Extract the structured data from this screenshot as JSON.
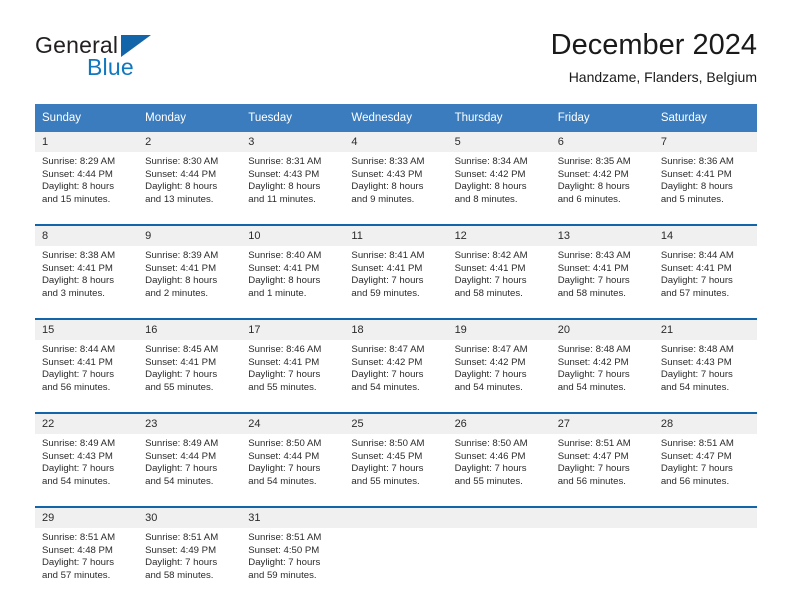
{
  "brand": {
    "name_top": "General",
    "name_bottom": "Blue",
    "triangle_color": "#1265a8",
    "blue_text_color": "#1178c0"
  },
  "header": {
    "month_title": "December 2024",
    "location": "Handzame, Flanders, Belgium"
  },
  "theme": {
    "header_row_bg": "#3a7cbe",
    "header_row_text": "#ffffff",
    "daynum_bg": "#f0f0f0",
    "separator": "#1265a8",
    "cell_text": "#2b2b2b"
  },
  "weekday_headers": [
    "Sunday",
    "Monday",
    "Tuesday",
    "Wednesday",
    "Thursday",
    "Friday",
    "Saturday"
  ],
  "weeks": [
    {
      "days": [
        {
          "day": "1",
          "sunrise": "Sunrise: 8:29 AM",
          "sunset": "Sunset: 4:44 PM",
          "daylight_1": "Daylight: 8 hours",
          "daylight_2": "and 15 minutes."
        },
        {
          "day": "2",
          "sunrise": "Sunrise: 8:30 AM",
          "sunset": "Sunset: 4:44 PM",
          "daylight_1": "Daylight: 8 hours",
          "daylight_2": "and 13 minutes."
        },
        {
          "day": "3",
          "sunrise": "Sunrise: 8:31 AM",
          "sunset": "Sunset: 4:43 PM",
          "daylight_1": "Daylight: 8 hours",
          "daylight_2": "and 11 minutes."
        },
        {
          "day": "4",
          "sunrise": "Sunrise: 8:33 AM",
          "sunset": "Sunset: 4:43 PM",
          "daylight_1": "Daylight: 8 hours",
          "daylight_2": "and 9 minutes."
        },
        {
          "day": "5",
          "sunrise": "Sunrise: 8:34 AM",
          "sunset": "Sunset: 4:42 PM",
          "daylight_1": "Daylight: 8 hours",
          "daylight_2": "and 8 minutes."
        },
        {
          "day": "6",
          "sunrise": "Sunrise: 8:35 AM",
          "sunset": "Sunset: 4:42 PM",
          "daylight_1": "Daylight: 8 hours",
          "daylight_2": "and 6 minutes."
        },
        {
          "day": "7",
          "sunrise": "Sunrise: 8:36 AM",
          "sunset": "Sunset: 4:41 PM",
          "daylight_1": "Daylight: 8 hours",
          "daylight_2": "and 5 minutes."
        }
      ]
    },
    {
      "days": [
        {
          "day": "8",
          "sunrise": "Sunrise: 8:38 AM",
          "sunset": "Sunset: 4:41 PM",
          "daylight_1": "Daylight: 8 hours",
          "daylight_2": "and 3 minutes."
        },
        {
          "day": "9",
          "sunrise": "Sunrise: 8:39 AM",
          "sunset": "Sunset: 4:41 PM",
          "daylight_1": "Daylight: 8 hours",
          "daylight_2": "and 2 minutes."
        },
        {
          "day": "10",
          "sunrise": "Sunrise: 8:40 AM",
          "sunset": "Sunset: 4:41 PM",
          "daylight_1": "Daylight: 8 hours",
          "daylight_2": "and 1 minute."
        },
        {
          "day": "11",
          "sunrise": "Sunrise: 8:41 AM",
          "sunset": "Sunset: 4:41 PM",
          "daylight_1": "Daylight: 7 hours",
          "daylight_2": "and 59 minutes."
        },
        {
          "day": "12",
          "sunrise": "Sunrise: 8:42 AM",
          "sunset": "Sunset: 4:41 PM",
          "daylight_1": "Daylight: 7 hours",
          "daylight_2": "and 58 minutes."
        },
        {
          "day": "13",
          "sunrise": "Sunrise: 8:43 AM",
          "sunset": "Sunset: 4:41 PM",
          "daylight_1": "Daylight: 7 hours",
          "daylight_2": "and 58 minutes."
        },
        {
          "day": "14",
          "sunrise": "Sunrise: 8:44 AM",
          "sunset": "Sunset: 4:41 PM",
          "daylight_1": "Daylight: 7 hours",
          "daylight_2": "and 57 minutes."
        }
      ]
    },
    {
      "days": [
        {
          "day": "15",
          "sunrise": "Sunrise: 8:44 AM",
          "sunset": "Sunset: 4:41 PM",
          "daylight_1": "Daylight: 7 hours",
          "daylight_2": "and 56 minutes."
        },
        {
          "day": "16",
          "sunrise": "Sunrise: 8:45 AM",
          "sunset": "Sunset: 4:41 PM",
          "daylight_1": "Daylight: 7 hours",
          "daylight_2": "and 55 minutes."
        },
        {
          "day": "17",
          "sunrise": "Sunrise: 8:46 AM",
          "sunset": "Sunset: 4:41 PM",
          "daylight_1": "Daylight: 7 hours",
          "daylight_2": "and 55 minutes."
        },
        {
          "day": "18",
          "sunrise": "Sunrise: 8:47 AM",
          "sunset": "Sunset: 4:42 PM",
          "daylight_1": "Daylight: 7 hours",
          "daylight_2": "and 54 minutes."
        },
        {
          "day": "19",
          "sunrise": "Sunrise: 8:47 AM",
          "sunset": "Sunset: 4:42 PM",
          "daylight_1": "Daylight: 7 hours",
          "daylight_2": "and 54 minutes."
        },
        {
          "day": "20",
          "sunrise": "Sunrise: 8:48 AM",
          "sunset": "Sunset: 4:42 PM",
          "daylight_1": "Daylight: 7 hours",
          "daylight_2": "and 54 minutes."
        },
        {
          "day": "21",
          "sunrise": "Sunrise: 8:48 AM",
          "sunset": "Sunset: 4:43 PM",
          "daylight_1": "Daylight: 7 hours",
          "daylight_2": "and 54 minutes."
        }
      ]
    },
    {
      "days": [
        {
          "day": "22",
          "sunrise": "Sunrise: 8:49 AM",
          "sunset": "Sunset: 4:43 PM",
          "daylight_1": "Daylight: 7 hours",
          "daylight_2": "and 54 minutes."
        },
        {
          "day": "23",
          "sunrise": "Sunrise: 8:49 AM",
          "sunset": "Sunset: 4:44 PM",
          "daylight_1": "Daylight: 7 hours",
          "daylight_2": "and 54 minutes."
        },
        {
          "day": "24",
          "sunrise": "Sunrise: 8:50 AM",
          "sunset": "Sunset: 4:44 PM",
          "daylight_1": "Daylight: 7 hours",
          "daylight_2": "and 54 minutes."
        },
        {
          "day": "25",
          "sunrise": "Sunrise: 8:50 AM",
          "sunset": "Sunset: 4:45 PM",
          "daylight_1": "Daylight: 7 hours",
          "daylight_2": "and 55 minutes."
        },
        {
          "day": "26",
          "sunrise": "Sunrise: 8:50 AM",
          "sunset": "Sunset: 4:46 PM",
          "daylight_1": "Daylight: 7 hours",
          "daylight_2": "and 55 minutes."
        },
        {
          "day": "27",
          "sunrise": "Sunrise: 8:51 AM",
          "sunset": "Sunset: 4:47 PM",
          "daylight_1": "Daylight: 7 hours",
          "daylight_2": "and 56 minutes."
        },
        {
          "day": "28",
          "sunrise": "Sunrise: 8:51 AM",
          "sunset": "Sunset: 4:47 PM",
          "daylight_1": "Daylight: 7 hours",
          "daylight_2": "and 56 minutes."
        }
      ]
    },
    {
      "days": [
        {
          "day": "29",
          "sunrise": "Sunrise: 8:51 AM",
          "sunset": "Sunset: 4:48 PM",
          "daylight_1": "Daylight: 7 hours",
          "daylight_2": "and 57 minutes."
        },
        {
          "day": "30",
          "sunrise": "Sunrise: 8:51 AM",
          "sunset": "Sunset: 4:49 PM",
          "daylight_1": "Daylight: 7 hours",
          "daylight_2": "and 58 minutes."
        },
        {
          "day": "31",
          "sunrise": "Sunrise: 8:51 AM",
          "sunset": "Sunset: 4:50 PM",
          "daylight_1": "Daylight: 7 hours",
          "daylight_2": "and 59 minutes."
        },
        {
          "day": "",
          "sunrise": "",
          "sunset": "",
          "daylight_1": "",
          "daylight_2": ""
        },
        {
          "day": "",
          "sunrise": "",
          "sunset": "",
          "daylight_1": "",
          "daylight_2": ""
        },
        {
          "day": "",
          "sunrise": "",
          "sunset": "",
          "daylight_1": "",
          "daylight_2": ""
        },
        {
          "day": "",
          "sunrise": "",
          "sunset": "",
          "daylight_1": "",
          "daylight_2": ""
        }
      ]
    }
  ]
}
